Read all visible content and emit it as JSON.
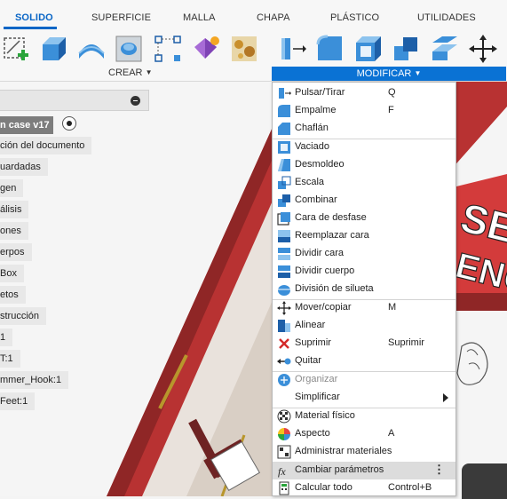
{
  "tabs": [
    {
      "label": "SOLIDO",
      "active": true
    },
    {
      "label": "SUPERFICIE"
    },
    {
      "label": "MALLA"
    },
    {
      "label": "CHAPA"
    },
    {
      "label": "PLÁSTICO"
    },
    {
      "label": "UTILIDADES"
    }
  ],
  "toolbar": {
    "crear_label": "CREAR",
    "modificar_label": "MODIFICAR",
    "caret": "▼"
  },
  "browser": {
    "root_label": "n case v17",
    "items": [
      "ción del documento",
      "uardadas",
      "gen",
      "álisis",
      "ones",
      "erpos",
      "Box",
      "etos",
      "strucción",
      "1",
      "T:1",
      "mmer_Hook:1",
      "Feet:1"
    ]
  },
  "menu": {
    "items": [
      {
        "label": "Pulsar/Tirar",
        "shortcut": "Q",
        "icon": "press-pull-icon"
      },
      {
        "label": "Empalme",
        "shortcut": "F",
        "icon": "fillet-icon"
      },
      {
        "label": "Chaflán",
        "shortcut": "",
        "icon": "chamfer-icon"
      },
      {
        "label": "Vaciado",
        "shortcut": "",
        "icon": "shell-icon"
      },
      {
        "label": "Desmoldeo",
        "shortcut": "",
        "icon": "draft-icon"
      },
      {
        "label": "Escala",
        "shortcut": "",
        "icon": "scale-icon"
      },
      {
        "label": "Combinar",
        "shortcut": "",
        "icon": "combine-icon"
      },
      {
        "label": "Cara de desfase",
        "shortcut": "",
        "icon": "offset-face-icon"
      },
      {
        "label": "Reemplazar cara",
        "shortcut": "",
        "icon": "replace-face-icon"
      },
      {
        "label": "Dividir cara",
        "shortcut": "",
        "icon": "split-face-icon"
      },
      {
        "label": "Dividir cuerpo",
        "shortcut": "",
        "icon": "split-body-icon"
      },
      {
        "label": "División de silueta",
        "shortcut": "",
        "icon": "silhouette-split-icon"
      },
      {
        "label": "Mover/copiar",
        "shortcut": "M",
        "icon": "move-icon"
      },
      {
        "label": "Alinear",
        "shortcut": "",
        "icon": "align-icon"
      },
      {
        "label": "Suprimir",
        "shortcut": "Suprimir",
        "icon": "delete-icon"
      },
      {
        "label": "Quitar",
        "shortcut": "",
        "icon": "remove-icon"
      },
      {
        "label": "Organizar",
        "shortcut": "",
        "icon": "arrange-icon"
      },
      {
        "label": "Simplificar",
        "shortcut": "",
        "icon": "simplify-icon"
      },
      {
        "label": "Material físico",
        "shortcut": "",
        "icon": "physical-material-icon"
      },
      {
        "label": "Aspecto",
        "shortcut": "A",
        "icon": "appearance-icon"
      },
      {
        "label": "Administrar materiales",
        "shortcut": "",
        "icon": "manage-materials-icon"
      },
      {
        "label": "Cambiar parámetros",
        "shortcut": "",
        "icon": "change-parameters-icon"
      },
      {
        "label": "Calcular todo",
        "shortcut": "Control+B",
        "icon": "compute-all-icon"
      }
    ]
  },
  "canvas": {
    "model_text": [
      "SE",
      "ENC"
    ]
  },
  "colors": {
    "accent": "#0a72d4",
    "model_red": "#c43a3a",
    "model_red_dark": "#8f2626"
  }
}
